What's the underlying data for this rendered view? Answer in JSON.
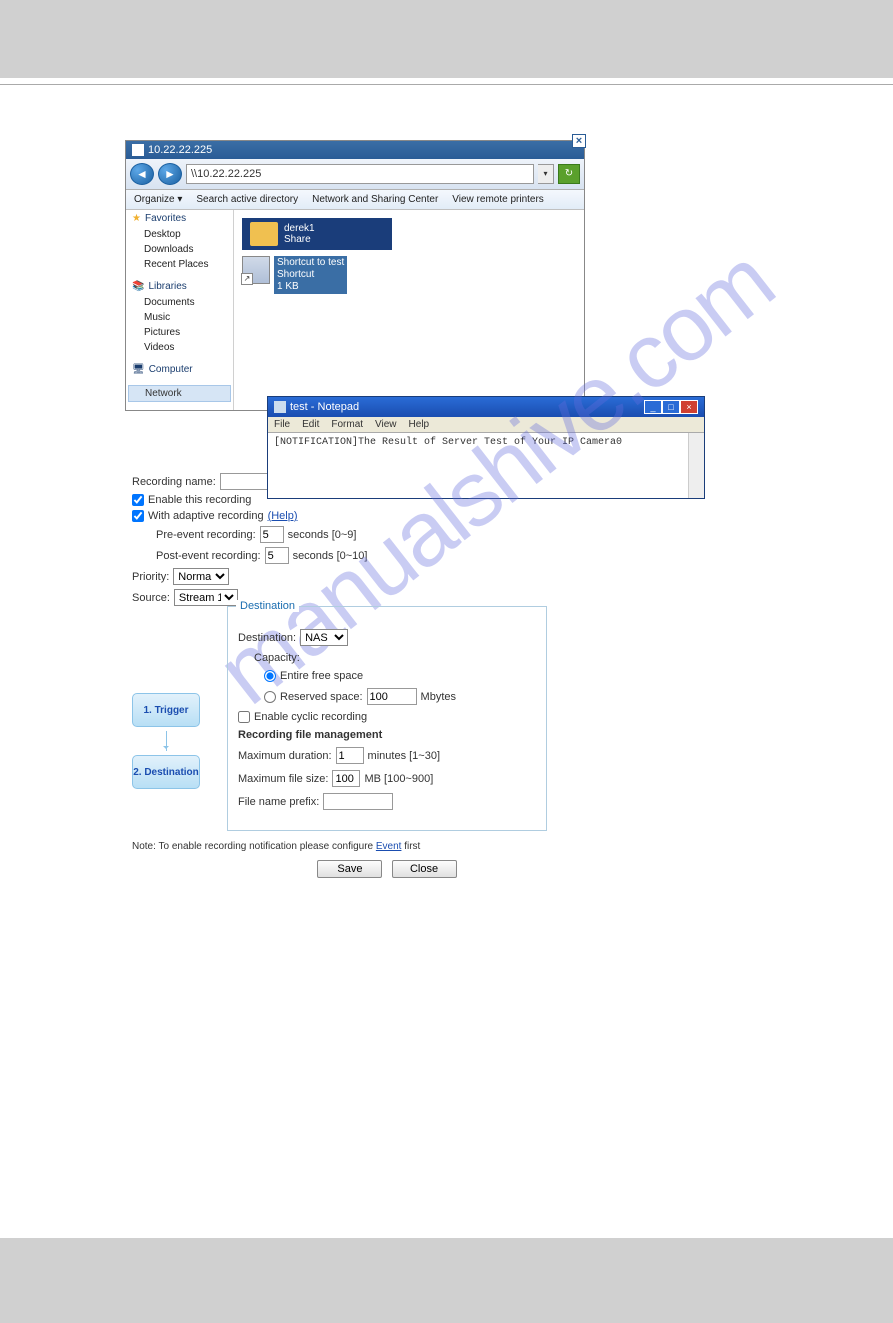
{
  "explorer": {
    "title": "10.22.22.225",
    "address": "\\\\10.22.22.225",
    "toolbar": {
      "organize": "Organize ▾",
      "search_ad": "Search active directory",
      "net_center": "Network and Sharing Center",
      "view_printers": "View remote printers"
    },
    "sidebar": {
      "favorites": "Favorites",
      "desktop": "Desktop",
      "downloads": "Downloads",
      "recent": "Recent Places",
      "libraries": "Libraries",
      "documents": "Documents",
      "music": "Music",
      "pictures": "Pictures",
      "videos": "Videos",
      "computer": "Computer",
      "network": "Network"
    },
    "folder": {
      "name": "derek1",
      "type": "Share"
    },
    "shortcut": {
      "line1": "Shortcut to test",
      "line2": "Shortcut",
      "line3": "1 KB"
    }
  },
  "notepad": {
    "title": "test - Notepad",
    "menu": {
      "file": "File",
      "edit": "Edit",
      "format": "Format",
      "view": "View",
      "help": "Help"
    },
    "content": "[NOTIFICATION]The Result of Server Test of Your IP Camera0"
  },
  "form": {
    "recording_name_label": "Recording name:",
    "recording_name": "",
    "enable_recording": "Enable this recording",
    "adaptive_recording": "With adaptive recording",
    "help": "(Help)",
    "pre_event_label": "Pre-event recording:",
    "pre_event_val": "5",
    "pre_event_suffix": "seconds [0~9]",
    "post_event_label": "Post-event recording:",
    "post_event_val": "5",
    "post_event_suffix": "seconds [0~10]",
    "priority_label": "Priority:",
    "priority_val": "Normal",
    "source_label": "Source:",
    "source_val": "Stream 1"
  },
  "steps": {
    "s1": "1. Trigger",
    "s2": "2. Destination"
  },
  "dest": {
    "legend": "Destination",
    "destination_label": "Destination:",
    "destination_val": "NAS",
    "capacity_label": "Capacity:",
    "entire_free": "Entire free space",
    "reserved_label": "Reserved space:",
    "reserved_val": "100",
    "reserved_unit": "Mbytes",
    "cyclic": "Enable cyclic recording",
    "rfm": "Recording file management",
    "max_dur_label": "Maximum duration:",
    "max_dur_val": "1",
    "max_dur_suffix": "minutes [1~30]",
    "max_size_label": "Maximum file size:",
    "max_size_val": "100",
    "max_size_suffix": "MB [100~900]",
    "prefix_label": "File name prefix:",
    "prefix_val": ""
  },
  "note": {
    "text1": "Note: To enable recording notification please configure ",
    "link": "Event",
    "text2": " first"
  },
  "buttons": {
    "save": "Save",
    "close": "Close"
  },
  "watermark": "manualshive.com"
}
